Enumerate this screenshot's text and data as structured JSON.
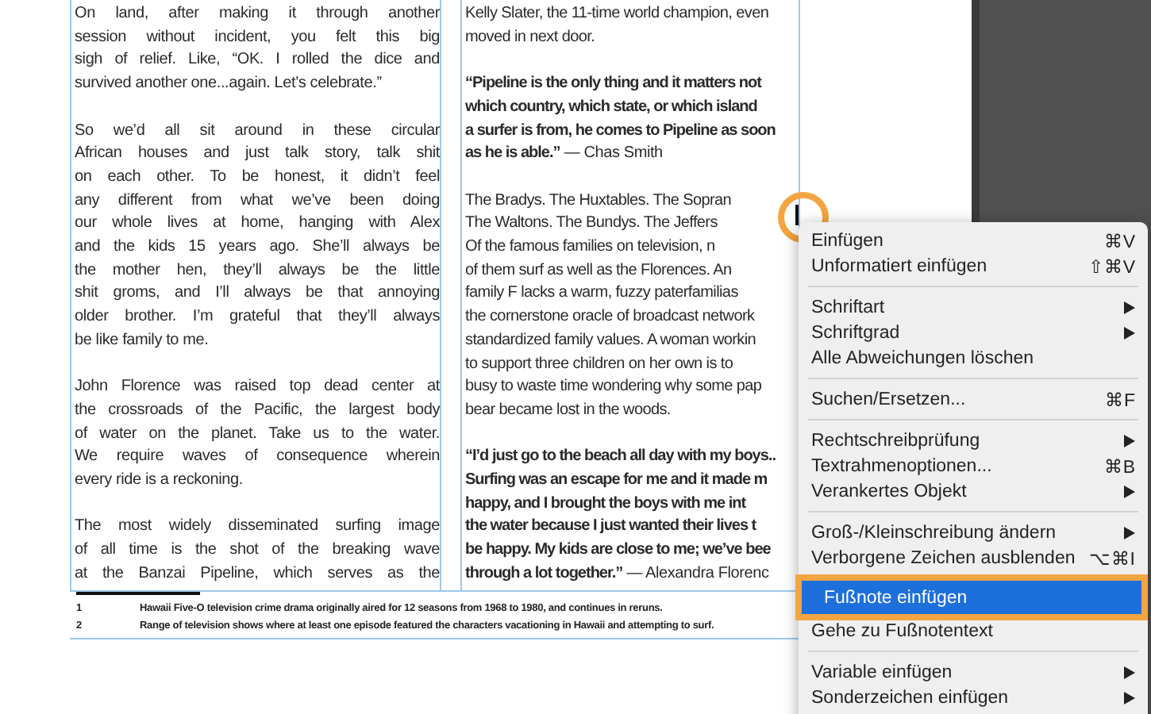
{
  "columns": [
    {
      "paragraphs": [
        {
          "kind": "body",
          "lines": [
            "On land, after making it through another",
            "session without incident, you felt this big",
            "sigh of relief. Like, “OK. I rolled the dice and",
            "survived another one...again. Let’s celebrate.”"
          ]
        },
        {
          "kind": "body",
          "lines": [
            "So we’d all sit around in these circular",
            "African houses and just talk story, talk shit",
            "on each other. To be honest, it didn’t feel",
            "any different from what we’ve been doing",
            "our whole lives at home, hanging with Alex",
            "and the kids 15 years ago. She’ll always be",
            "the mother hen, they’ll always be the little",
            "shit groms, and I’ll always be that annoying",
            "older brother. I’m grateful that they’ll always",
            "be like family to me."
          ]
        },
        {
          "kind": "body",
          "lines": [
            "John Florence was raised top dead center at",
            "the crossroads of the Pacific, the largest body",
            "of water on the planet. Take us to the water.",
            "We require waves of consequence wherein",
            "every ride is a reckoning."
          ]
        },
        {
          "kind": "body",
          "lines": [
            "The most widely disseminated surfing image",
            "of all time is the shot of the breaking wave",
            "at the Banzai Pipeline, which serves as the"
          ],
          "continues": true
        }
      ]
    },
    {
      "paragraphs": [
        {
          "kind": "body",
          "lines": [
            "Kelly Slater, the 11-time world champion, even",
            "moved in next door."
          ]
        },
        {
          "kind": "quote",
          "lines": [
            "“Pipeline is the only thing and it matters not",
            "which country, which state, or which island",
            "a surfer is from, he comes to Pipeline as soon",
            "as he is able.”"
          ],
          "attribution": "— Chas Smith"
        },
        {
          "kind": "body",
          "lines": [
            "The Bradys. The Huxtables. The Sopran",
            "The Waltons. The Bundys. The Jeffers",
            "Of the famous families on television, n",
            "of them surf as well as the Florences. An",
            "family F lacks a warm, fuzzy paterfamilias",
            "the cornerstone oracle of broadcast network",
            "standardized family values. A woman workin",
            "to support three children on her own is to",
            "busy to waste time wondering why some pap",
            "bear became lost in the woods."
          ]
        },
        {
          "kind": "quote",
          "lines": [
            "“I’d just go to the beach all day with my boys..",
            "Surfing was an escape for me and it made m",
            "happy, and I brought the boys with me int",
            "the water because I just wanted their lives t",
            "be happy. My kids are close to me; we’ve bee",
            "through a lot together.”"
          ],
          "attribution": "— Alexandra Florenc"
        }
      ]
    }
  ],
  "footnotes": [
    {
      "number": "1",
      "text": "Hawaii Five-O television crime drama originally aired for 12 seasons from 1968 to 1980, and continues in reruns."
    },
    {
      "number": "2",
      "text": "Range of television shows where at least one episode featured the characters vacationing in Hawaii and attempting to surf."
    }
  ],
  "menu": {
    "sections": [
      [
        {
          "label": "Einfügen",
          "shortcut": "⌘V",
          "submenu": false,
          "selected": false
        },
        {
          "label": "Unformatiert einfügen",
          "shortcut": "⇧⌘V",
          "submenu": false,
          "selected": false
        }
      ],
      [
        {
          "label": "Schriftart",
          "submenu": true,
          "selected": false
        },
        {
          "label": "Schriftgrad",
          "submenu": true,
          "selected": false
        },
        {
          "label": "Alle Abweichungen löschen",
          "submenu": false,
          "selected": false
        }
      ],
      [
        {
          "label": "Suchen/Ersetzen...",
          "shortcut": "⌘F",
          "submenu": false,
          "selected": false
        }
      ],
      [
        {
          "label": "Rechtschreibprüfung",
          "submenu": true,
          "selected": false
        },
        {
          "label": "Textrahmenoptionen...",
          "shortcut": "⌘B",
          "submenu": false,
          "selected": false
        },
        {
          "label": "Verankertes Objekt",
          "submenu": true,
          "selected": false
        }
      ],
      [
        {
          "label": "Groß-/Kleinschreibung ändern",
          "submenu": true,
          "selected": false
        },
        {
          "label": "Verborgene Zeichen ausblenden",
          "shortcut": "⌥⌘I",
          "submenu": false,
          "selected": false
        },
        {
          "label": "Fußnote einfügen",
          "submenu": false,
          "selected": true
        },
        {
          "label": "Gehe zu Fußnotentext",
          "submenu": false,
          "selected": false
        }
      ],
      [
        {
          "label": "Variable einfügen",
          "submenu": true,
          "selected": false
        },
        {
          "label": "Sonderzeichen einfügen",
          "submenu": true,
          "selected": false
        }
      ]
    ]
  }
}
